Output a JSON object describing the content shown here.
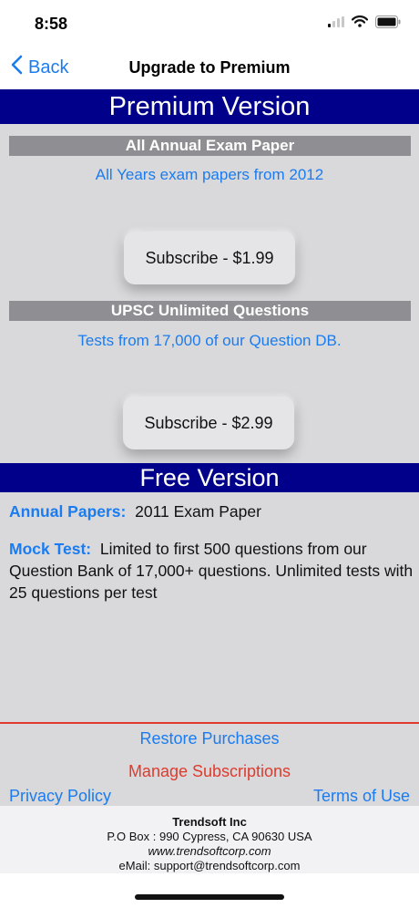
{
  "status": {
    "time": "8:58"
  },
  "nav": {
    "back_label": "Back",
    "title": "Upgrade to Premium"
  },
  "premium": {
    "banner": "Premium  Version",
    "plans": [
      {
        "header": "All Annual Exam Paper",
        "subtitle": "All Years exam papers from 2012",
        "button": "Subscribe - $1.99"
      },
      {
        "header": "UPSC Unlimited Questions",
        "subtitle": "Tests from 17,000 of our Question DB.",
        "button": "Subscribe - $2.99"
      }
    ]
  },
  "free": {
    "banner": "Free Version",
    "items": [
      {
        "label": "Annual Papers:",
        "text": "2011 Exam Paper"
      },
      {
        "label": "Mock Test:",
        "text": "Limited to first 500 questions from our Question Bank of 17,000+ questions. Unlimited tests with 25 questions per test"
      }
    ]
  },
  "footer": {
    "restore": "Restore Purchases",
    "manage": "Manage Subscriptions",
    "privacy": "Privacy Policy",
    "terms": "Terms of Use"
  },
  "company": {
    "name": "Trendsoft Inc",
    "address": "P.O Box : 990 Cypress, CA 90630 USA",
    "website": "www.trendsoftcorp.com",
    "email": "eMail: support@trendsoftcorp.com"
  },
  "colors": {
    "banner": "#00008a",
    "section_bar": "#8e8e93",
    "link_blue": "#1a7cf0",
    "accent_red": "#e03a2c",
    "content_bg": "#d9d9dc"
  },
  "icons": [
    "chevron-left-icon",
    "signal-icon",
    "wifi-icon",
    "battery-icon"
  ]
}
